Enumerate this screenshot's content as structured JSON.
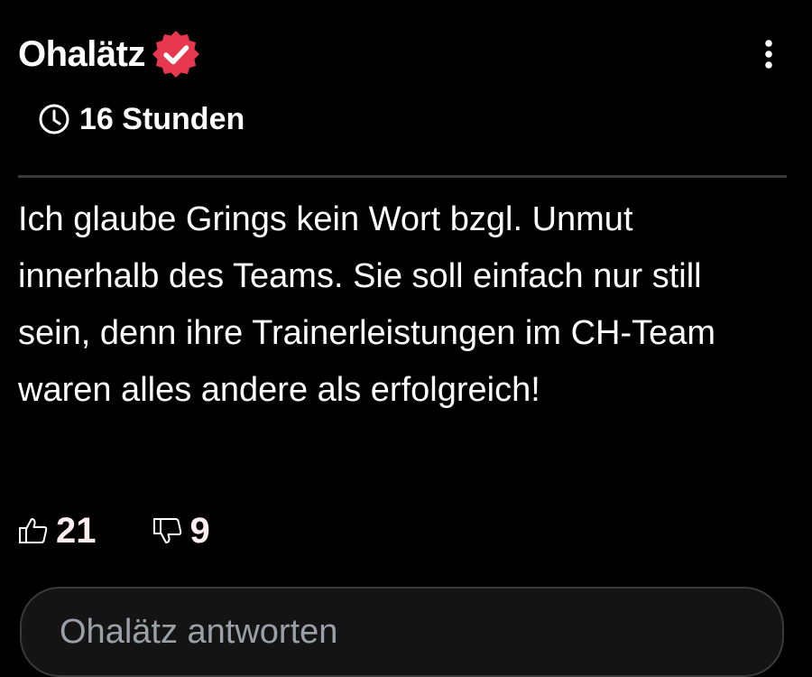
{
  "comment": {
    "author": "Ohalätz",
    "verified_badge": {
      "icon": "verified-badge-icon",
      "color": "#e8384f"
    },
    "menu_icon": "more-vertical-icon",
    "timestamp": {
      "icon": "clock-icon",
      "label": "16 Stunden"
    },
    "text": "Ich glaube Grings kein Wort bzgl. Unmut innerhalb des Teams. Sie soll einfach nur still sein, denn ihre Trainerleistungen im CH-Team waren alles andere als erfolgreich!",
    "upvotes": {
      "icon": "thumbs-up-icon",
      "count": "21"
    },
    "downvotes": {
      "icon": "thumbs-down-icon",
      "count": "9"
    }
  },
  "reply": {
    "placeholder": "Ohalätz antworten"
  },
  "colors": {
    "background": "#000000",
    "text": "#ffffff",
    "accent": "#e8384f",
    "divider": "#3a3a3a",
    "input_background": "#141414",
    "placeholder": "#9aa0a6"
  }
}
